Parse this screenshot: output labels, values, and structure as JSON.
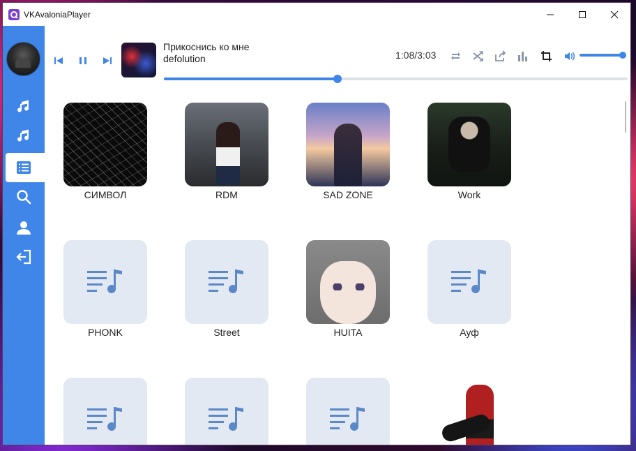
{
  "window": {
    "title": "VKAvaloniaPlayer"
  },
  "sidebar": {
    "items": [
      {
        "id": "music",
        "icon": "music-note-icon"
      },
      {
        "id": "recommendations",
        "icon": "music-note-icon"
      },
      {
        "id": "playlists",
        "icon": "list-icon",
        "active": true
      },
      {
        "id": "search",
        "icon": "search-icon"
      },
      {
        "id": "profile",
        "icon": "user-icon"
      },
      {
        "id": "logout",
        "icon": "logout-icon"
      }
    ]
  },
  "player": {
    "track_title": "Прикоснись ко мне",
    "track_artist": "defolution",
    "time": "1:08/3:03",
    "progress": 0.375,
    "volume": 0.95
  },
  "playlists": [
    {
      "title": "СИМВОЛ",
      "art": "art-simvol"
    },
    {
      "title": "RDM",
      "art": "art-rdm"
    },
    {
      "title": "SAD ZONE",
      "art": "art-sad"
    },
    {
      "title": "Work",
      "art": "art-work"
    },
    {
      "title": "PHONK",
      "art": "placeholder"
    },
    {
      "title": "Street",
      "art": "placeholder"
    },
    {
      "title": "HUITA",
      "art": "art-huita"
    },
    {
      "title": "Ауф",
      "art": "placeholder"
    },
    {
      "title": "",
      "art": "placeholder"
    },
    {
      "title": "",
      "art": "placeholder"
    },
    {
      "title": "",
      "art": "placeholder"
    },
    {
      "title": "",
      "art": "art-guitar"
    }
  ],
  "colors": {
    "accent": "#3f86e8",
    "placeholder_bg": "#e3e9f2",
    "placeholder_icon": "#5b88c7"
  }
}
